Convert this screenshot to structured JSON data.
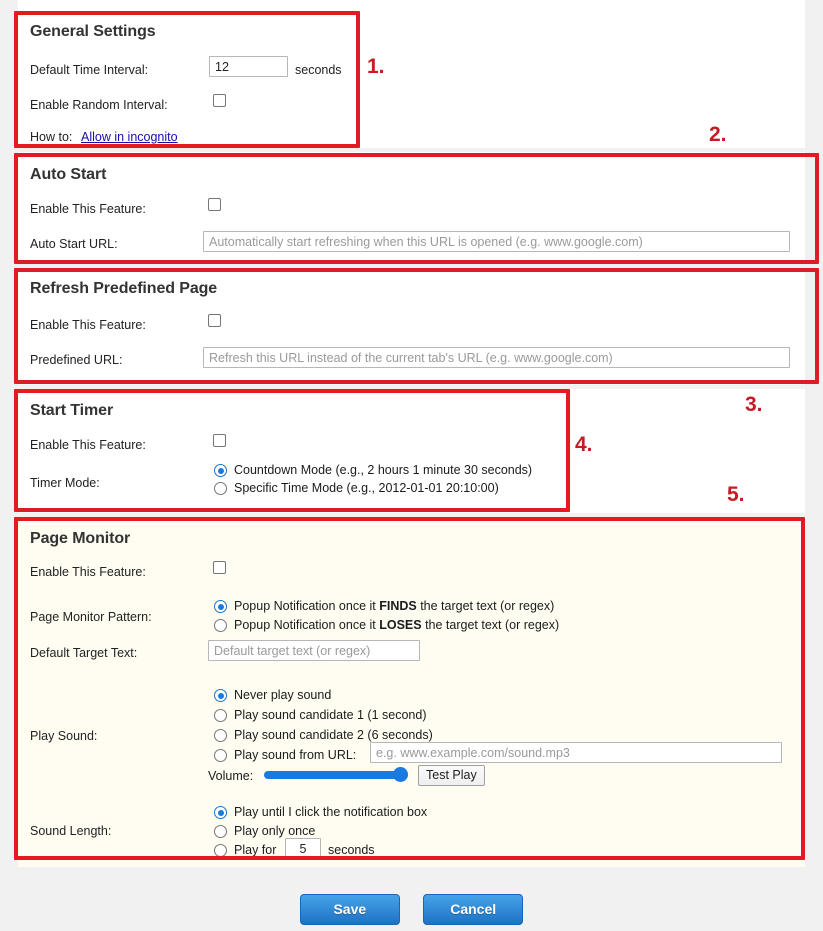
{
  "general": {
    "title": "General Settings",
    "interval_label": "Default Time Interval:",
    "interval_value": "12",
    "interval_unit": "seconds",
    "random_label": "Enable Random Interval:",
    "howto_label": "How to:",
    "howto_link": "Allow in incognito"
  },
  "auto_start": {
    "title": "Auto Start",
    "enable_label": "Enable This Feature:",
    "url_label": "Auto Start URL:",
    "url_placeholder": "Automatically start refreshing when this URL is opened (e.g. www.google.com)",
    "url_value": ""
  },
  "refresh_predefined": {
    "title": "Refresh Predefined Page",
    "enable_label": "Enable This Feature:",
    "url_label": "Predefined URL:",
    "url_placeholder": "Refresh this URL instead of the current tab's URL (e.g. www.google.com)",
    "url_value": ""
  },
  "start_timer": {
    "title": "Start Timer",
    "enable_label": "Enable This Feature:",
    "mode_label": "Timer Mode:",
    "modes": [
      {
        "label": "Countdown Mode (e.g., 2 hours 1 minute 30 seconds)",
        "selected": true
      },
      {
        "label": "Specific Time Mode (e.g., 2012-01-01 20:10:00)",
        "selected": false
      }
    ]
  },
  "page_monitor": {
    "title": "Page Monitor",
    "enable_label": "Enable This Feature:",
    "pattern_label": "Page Monitor Pattern:",
    "patterns": [
      {
        "pre": "Popup Notification once it ",
        "strong": "FINDS",
        "post": " the target text (or regex)",
        "selected": true
      },
      {
        "pre": "Popup Notification once it ",
        "strong": "LOSES",
        "post": " the target text (or regex)",
        "selected": false
      }
    ],
    "target_label": "Default Target Text:",
    "target_placeholder": "Default target text (or regex)",
    "target_value": "",
    "play_sound_label": "Play Sound:",
    "sound_options": [
      {
        "label": "Never play sound",
        "selected": true
      },
      {
        "label": "Play sound candidate 1 (1 second)",
        "selected": false
      },
      {
        "label": "Play sound candidate 2 (6 seconds)",
        "selected": false
      },
      {
        "label": "Play sound from URL:",
        "selected": false
      }
    ],
    "sound_url_placeholder": "e.g. www.example.com/sound.mp3",
    "sound_url_value": "",
    "volume_label": "Volume:",
    "volume_value": "100",
    "test_play_label": "Test Play",
    "sound_length_label": "Sound Length:",
    "length_options": [
      {
        "label": "Play until I click the notification box",
        "selected": true
      },
      {
        "label": "Play only once",
        "selected": false
      },
      {
        "label": "Play for",
        "selected": false
      }
    ],
    "play_for_value": "5",
    "play_for_unit": "seconds"
  },
  "footer": {
    "save_label": "Save",
    "cancel_label": "Cancel"
  },
  "annotations": {
    "items": [
      {
        "num": "1."
      },
      {
        "num": "2."
      },
      {
        "num": "3."
      },
      {
        "num": "4."
      },
      {
        "num": "5."
      }
    ],
    "accent_color": "#e01b22"
  }
}
